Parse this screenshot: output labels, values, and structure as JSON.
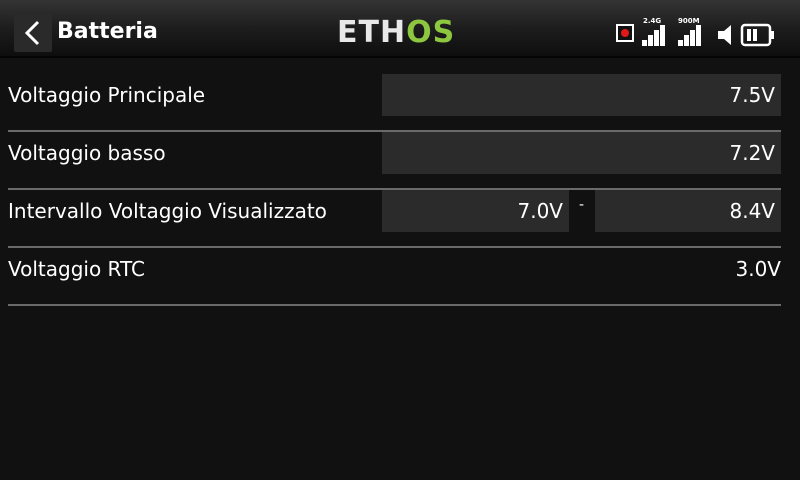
{
  "header": {
    "title": "Batteria",
    "logo": {
      "part1": "ETH",
      "part2": "OS"
    },
    "status": {
      "signal_1_label": "2.4G",
      "signal_2_label": "900M",
      "record_color": "#e01818"
    }
  },
  "rows": [
    {
      "label": "Voltaggio Principale",
      "value": "7.5V"
    },
    {
      "label": "Voltaggio basso",
      "value": "7.2V"
    },
    {
      "label": "Intervallo Voltaggio Visualizzato",
      "min": "7.0V",
      "separator": "-",
      "max": "8.4V"
    },
    {
      "label": "Voltaggio RTC",
      "value": "3.0V"
    }
  ],
  "colors": {
    "accent": "#8dc63f",
    "background": "#111111",
    "field": "#2b2b2b"
  }
}
